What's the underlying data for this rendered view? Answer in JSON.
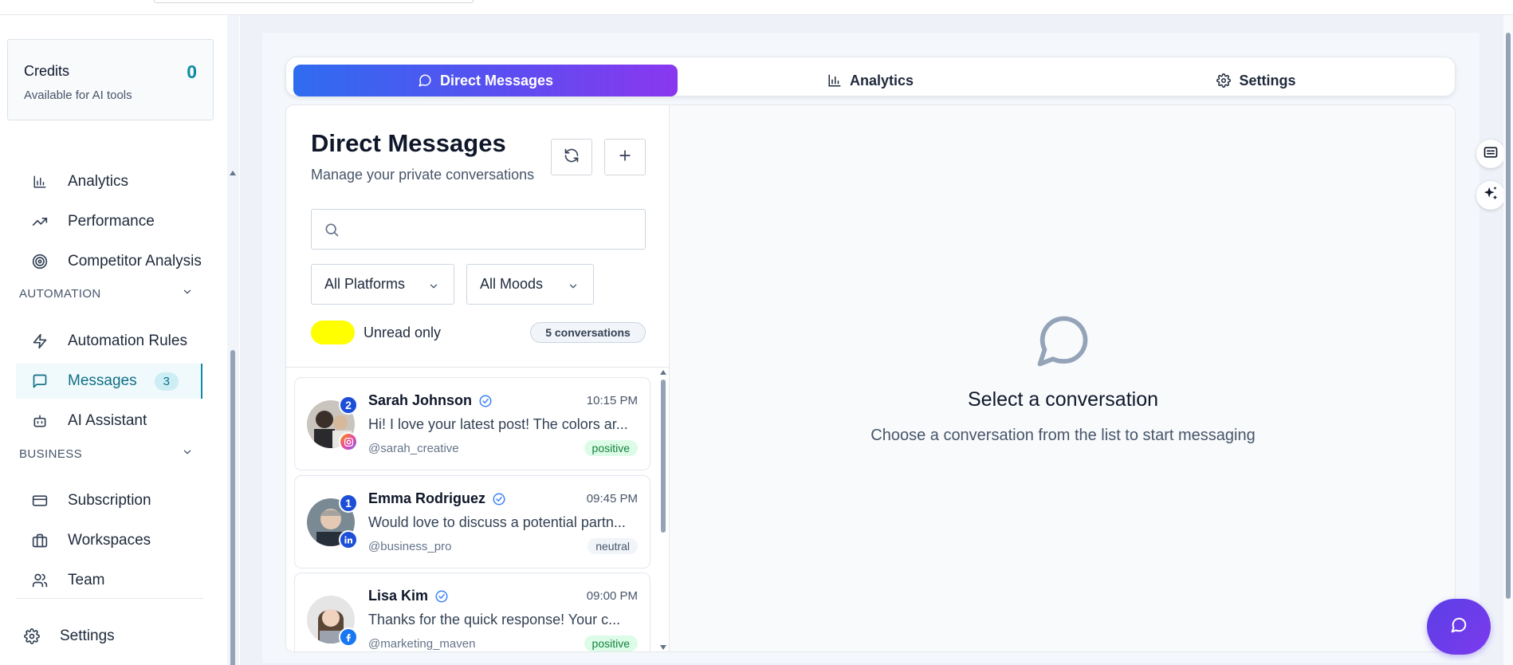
{
  "credits": {
    "label": "Credits",
    "count": "0",
    "sub": "Available for AI tools"
  },
  "sidebar": {
    "items": [
      {
        "label": "Analytics",
        "icon": "bar-chart-icon"
      },
      {
        "label": "Performance",
        "icon": "trending-up-icon"
      },
      {
        "label": "Competitor Analysis",
        "icon": "target-icon"
      },
      {
        "label": "Automation Rules",
        "icon": "zap-icon"
      },
      {
        "label": "Messages",
        "icon": "message-square-icon",
        "badge": "3",
        "active": true
      },
      {
        "label": "AI Assistant",
        "icon": "bot-icon"
      },
      {
        "label": "Subscription",
        "icon": "credit-card-icon"
      },
      {
        "label": "Workspaces",
        "icon": "briefcase-icon"
      },
      {
        "label": "Team",
        "icon": "users-icon"
      },
      {
        "label": "Settings",
        "icon": "gear-icon"
      }
    ],
    "sections": {
      "automation": "AUTOMATION",
      "business": "BUSINESS"
    }
  },
  "tabs": [
    {
      "label": "Direct Messages",
      "active": true
    },
    {
      "label": "Analytics"
    },
    {
      "label": "Settings"
    }
  ],
  "dm": {
    "title": "Direct Messages",
    "subtitle": "Manage your private conversations",
    "search_placeholder": "",
    "platform_filter": "All Platforms",
    "mood_filter": "All Moods",
    "unread_toggle_label": "Unread only",
    "conversation_count": "5 conversations"
  },
  "conversations": [
    {
      "name": "Sarah Johnson",
      "time": "10:15 PM",
      "preview": "Hi! I love your latest post! The colors ar...",
      "handle": "@sarah_creative",
      "mood": "positive",
      "unread": "2",
      "platform": "instagram"
    },
    {
      "name": "Emma Rodriguez",
      "time": "09:45 PM",
      "preview": "Would love to discuss a potential partn...",
      "handle": "@business_pro",
      "mood": "neutral",
      "unread": "1",
      "platform": "linkedin"
    },
    {
      "name": "Lisa Kim",
      "time": "09:00 PM",
      "preview": "Thanks for the quick response! Your c...",
      "handle": "@marketing_maven",
      "mood": "positive",
      "unread": "",
      "platform": "facebook"
    }
  ],
  "empty_state": {
    "title": "Select a conversation",
    "subtitle": "Choose a conversation from the list to start messaging"
  },
  "colors": {
    "accent": "#0e8aa8",
    "tab_gradient_start": "#2f6cf0",
    "tab_gradient_end": "#8a37ee",
    "toggle": "#ffff00",
    "positive": "#15803d"
  }
}
